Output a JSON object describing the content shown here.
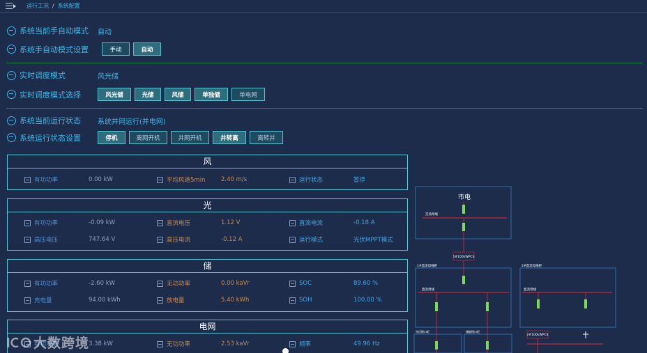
{
  "breadcrumb": {
    "first": "运行工况",
    "separator": "/",
    "second": "系统配置"
  },
  "rows": {
    "current_mode": {
      "label": "系统当前手自动模式",
      "value": "自动"
    },
    "mode_setting": {
      "label": "系统手自动模式设置",
      "buttons": [
        "手动",
        "自动"
      ]
    },
    "dispatch_mode": {
      "label": "实时调度模式",
      "value": "风光储"
    },
    "dispatch_select": {
      "label": "实时调度模式选择",
      "buttons": [
        "风光储",
        "光储",
        "风储",
        "单独储",
        "单电网"
      ]
    },
    "run_state": {
      "label": "系统当前运行状态",
      "value": "系统并网运行(并电网)"
    },
    "run_setting": {
      "label": "系统运行状态设置",
      "buttons": [
        "停机",
        "离网开机",
        "并网开机",
        "并转离",
        "离转并"
      ]
    }
  },
  "panels": {
    "wind": {
      "title": "风",
      "rows": [
        [
          {
            "label": "有功功率",
            "value": "0.00 kW"
          },
          {
            "label": "平均风速5min",
            "value": "2.40 m/s"
          },
          {
            "label": "运行状态",
            "value": "暂停"
          }
        ]
      ]
    },
    "solar": {
      "title": "光",
      "rows": [
        [
          {
            "label": "有功功率",
            "value": "-0.09 kW"
          },
          {
            "label": "直流电压",
            "value": "1.12 V"
          },
          {
            "label": "直流电流",
            "value": "-0.18 A"
          }
        ],
        [
          {
            "label": "高压电压",
            "value": "747.64 V"
          },
          {
            "label": "高压电流",
            "value": "-0.12 A"
          },
          {
            "label": "运行模式",
            "value": "光伏MPPT模式"
          }
        ]
      ]
    },
    "storage": {
      "title": "储",
      "rows": [
        [
          {
            "label": "有功功率",
            "value": "-2.60 kW"
          },
          {
            "label": "无功功率",
            "value": "0.00 kaVr"
          },
          {
            "label": "SOC",
            "value": "89.60 %"
          }
        ],
        [
          {
            "label": "充电量",
            "value": "94.00 kWh"
          },
          {
            "label": "放电量",
            "value": "5.40 kWh"
          },
          {
            "label": "SOH",
            "value": "100.00 %"
          }
        ]
      ]
    },
    "grid": {
      "title": "电网",
      "rows": [
        [
          {
            "label": "有功功率",
            "value": "3.38 kW"
          },
          {
            "label": "无功功率",
            "value": "2.53 kaVr"
          },
          {
            "label": "频率",
            "value": "49.96 Hz"
          }
        ]
      ]
    }
  },
  "diagram": {
    "top_label": "市电",
    "ac_bus": "交流母线",
    "pcs": "1#100kWPCS",
    "dc_panel_1": "1#直流母线柜",
    "dc_panel_2": "2#直流母线柜",
    "dc_bus_1": "直流母线",
    "dc_bus_2": "直流母线",
    "pcs2": "2#100kWPCS",
    "sub_1": "光伏接口柜",
    "sub_2": "储能接口柜"
  },
  "watermark": "大数跨境",
  "colors": {
    "background": "#1d2c4a",
    "accent": "#3fb7ea",
    "panel_border": "#5ac6d7",
    "divider": "#1e8a3a",
    "switch_green": "#7ed957",
    "line_red": "#c0283a"
  }
}
